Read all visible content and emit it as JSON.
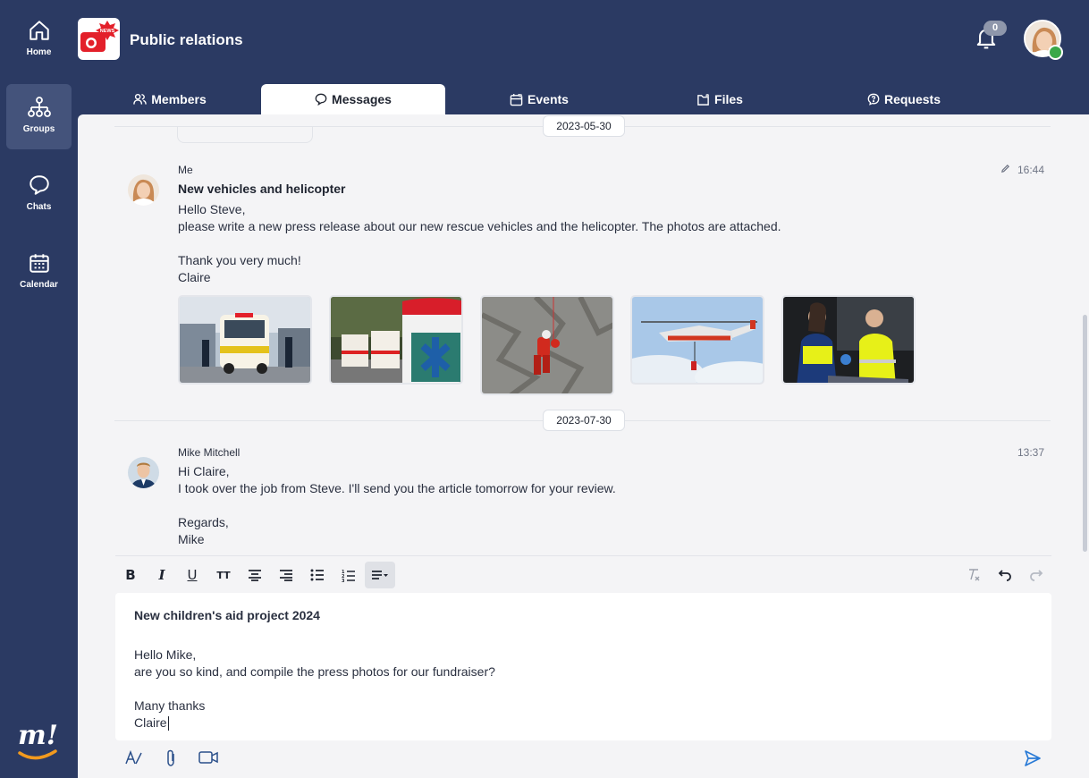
{
  "nav": {
    "items": [
      {
        "label": "Home",
        "icon": "home-icon"
      },
      {
        "label": "Groups",
        "icon": "groups-icon"
      },
      {
        "label": "Chats",
        "icon": "chat-bubble-icon"
      },
      {
        "label": "Calendar",
        "icon": "calendar-icon"
      }
    ],
    "logo_text": "m!"
  },
  "header": {
    "group_title": "Public relations",
    "group_logo_badge": "NEWS",
    "notification_count": "0"
  },
  "tabs": [
    {
      "label": "Members",
      "icon": "members-icon"
    },
    {
      "label": "Messages",
      "icon": "message-icon",
      "active": true
    },
    {
      "label": "Events",
      "icon": "events-icon"
    },
    {
      "label": "Files",
      "icon": "files-icon"
    },
    {
      "label": "Requests",
      "icon": "requests-icon"
    }
  ],
  "messages": [
    {
      "date": "2023-05-30",
      "author": "Me",
      "time": "16:44",
      "edited": true,
      "subject": "New vehicles and helicopter",
      "lines": [
        "Hello Steve,",
        "please write a new press release about our new rescue vehicles and the helicopter. The photos are attached.",
        "",
        "Thank you very much!",
        "Claire"
      ],
      "attachments": [
        "ambulance-front",
        "ambulances-parked",
        "mountain-rescue",
        "rescue-helicopter",
        "paramedics-patient"
      ]
    },
    {
      "date": "2023-07-30",
      "author": "Mike Mitchell",
      "time": "13:37",
      "lines": [
        "Hi Claire,",
        "I took over the job from Steve. I'll send you the article tomorrow for your review.",
        "",
        "Regards,",
        "Mike"
      ]
    }
  ],
  "editor": {
    "subject": "New children's aid project 2024",
    "lines": [
      "Hello Mike,",
      "are you so kind, and compile the press photos for our fundraiser?",
      "",
      "Many thanks",
      "Claire"
    ],
    "toolbar": {
      "bold": "B",
      "italic": "I",
      "underline": "U",
      "text_size": "TT"
    }
  },
  "colors": {
    "navy": "#2b3a63",
    "accent_blue": "#2a7bd6",
    "online": "#3aa84a"
  }
}
